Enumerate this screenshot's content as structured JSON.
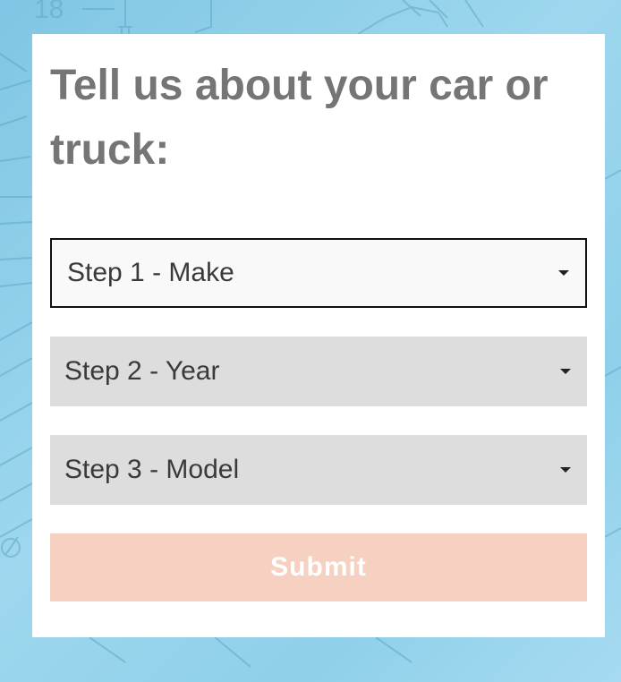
{
  "form": {
    "heading": "Tell us about your car or truck:",
    "selects": [
      {
        "label": "Step 1 - Make",
        "state": "active"
      },
      {
        "label": "Step 2 - Year",
        "state": "disabled"
      },
      {
        "label": "Step 3 - Model",
        "state": "disabled"
      }
    ],
    "submit_label": "Submit",
    "background_text": "18"
  },
  "colors": {
    "heading": "#757575",
    "active_select_bg": "#f9f9f9",
    "disabled_select_bg": "#dddddd",
    "submit_bg": "#f6d0c1",
    "page_bg": "#8fd0ea"
  },
  "icons": {
    "dropdown": "caret-down-icon"
  }
}
